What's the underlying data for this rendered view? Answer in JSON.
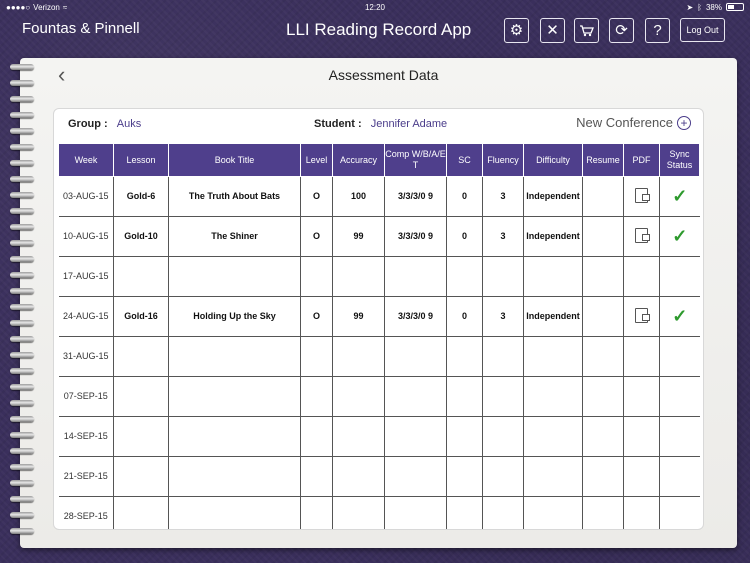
{
  "statusbar": {
    "carrier": "Verizon",
    "time": "12:20",
    "battery": "38%"
  },
  "header": {
    "brand": "Fountas & Pinnell",
    "title": "LLI Reading Record App",
    "logout_label": "Log Out",
    "icons": [
      "gear-icon",
      "tools-icon",
      "cart-icon",
      "sync-icon",
      "help-icon"
    ]
  },
  "page": {
    "title": "Assessment Data"
  },
  "info": {
    "group_label": "Group :",
    "group_value": "Auks",
    "student_label": "Student :",
    "student_value": "Jennifer Adame",
    "new_conference": "New Conference"
  },
  "table": {
    "headers": [
      "Week",
      "Lesson",
      "Book Title",
      "Level",
      "Accuracy",
      "Comp W/B/A/E T",
      "SC",
      "Fluency",
      "Difficulty",
      "Resume",
      "PDF",
      "Sync Status"
    ],
    "rows": [
      {
        "week": "03-AUG-15",
        "lesson": "Gold-6",
        "title": "The Truth About Bats",
        "level": "O",
        "accuracy": "100",
        "comp": "3/3/3/0  9",
        "sc": "0",
        "fluency": "3",
        "difficulty": "Independent",
        "resume": "",
        "pdf": true,
        "sync": true
      },
      {
        "week": "10-AUG-15",
        "lesson": "Gold-10",
        "title": "The Shiner",
        "level": "O",
        "accuracy": "99",
        "comp": "3/3/3/0  9",
        "sc": "0",
        "fluency": "3",
        "difficulty": "Independent",
        "resume": "",
        "pdf": true,
        "sync": true
      },
      {
        "week": "17-AUG-15",
        "lesson": "",
        "title": "",
        "level": "",
        "accuracy": "",
        "comp": "",
        "sc": "",
        "fluency": "",
        "difficulty": "",
        "resume": "",
        "pdf": false,
        "sync": false
      },
      {
        "week": "24-AUG-15",
        "lesson": "Gold-16",
        "title": "Holding Up the Sky",
        "level": "O",
        "accuracy": "99",
        "comp": "3/3/3/0  9",
        "sc": "0",
        "fluency": "3",
        "difficulty": "Independent",
        "resume": "",
        "pdf": true,
        "sync": true
      },
      {
        "week": "31-AUG-15",
        "lesson": "",
        "title": "",
        "level": "",
        "accuracy": "",
        "comp": "",
        "sc": "",
        "fluency": "",
        "difficulty": "",
        "resume": "",
        "pdf": false,
        "sync": false
      },
      {
        "week": "07-SEP-15",
        "lesson": "",
        "title": "",
        "level": "",
        "accuracy": "",
        "comp": "",
        "sc": "",
        "fluency": "",
        "difficulty": "",
        "resume": "",
        "pdf": false,
        "sync": false
      },
      {
        "week": "14-SEP-15",
        "lesson": "",
        "title": "",
        "level": "",
        "accuracy": "",
        "comp": "",
        "sc": "",
        "fluency": "",
        "difficulty": "",
        "resume": "",
        "pdf": false,
        "sync": false
      },
      {
        "week": "21-SEP-15",
        "lesson": "",
        "title": "",
        "level": "",
        "accuracy": "",
        "comp": "",
        "sc": "",
        "fluency": "",
        "difficulty": "",
        "resume": "",
        "pdf": false,
        "sync": false
      },
      {
        "week": "28-SEP-15",
        "lesson": "",
        "title": "",
        "level": "",
        "accuracy": "",
        "comp": "",
        "sc": "",
        "fluency": "",
        "difficulty": "",
        "resume": "",
        "pdf": false,
        "sync": false
      }
    ]
  },
  "colors": {
    "header_purple": "#4f3f8c",
    "sync_green": "#2e9a2e",
    "background": "#3a2f5c"
  }
}
